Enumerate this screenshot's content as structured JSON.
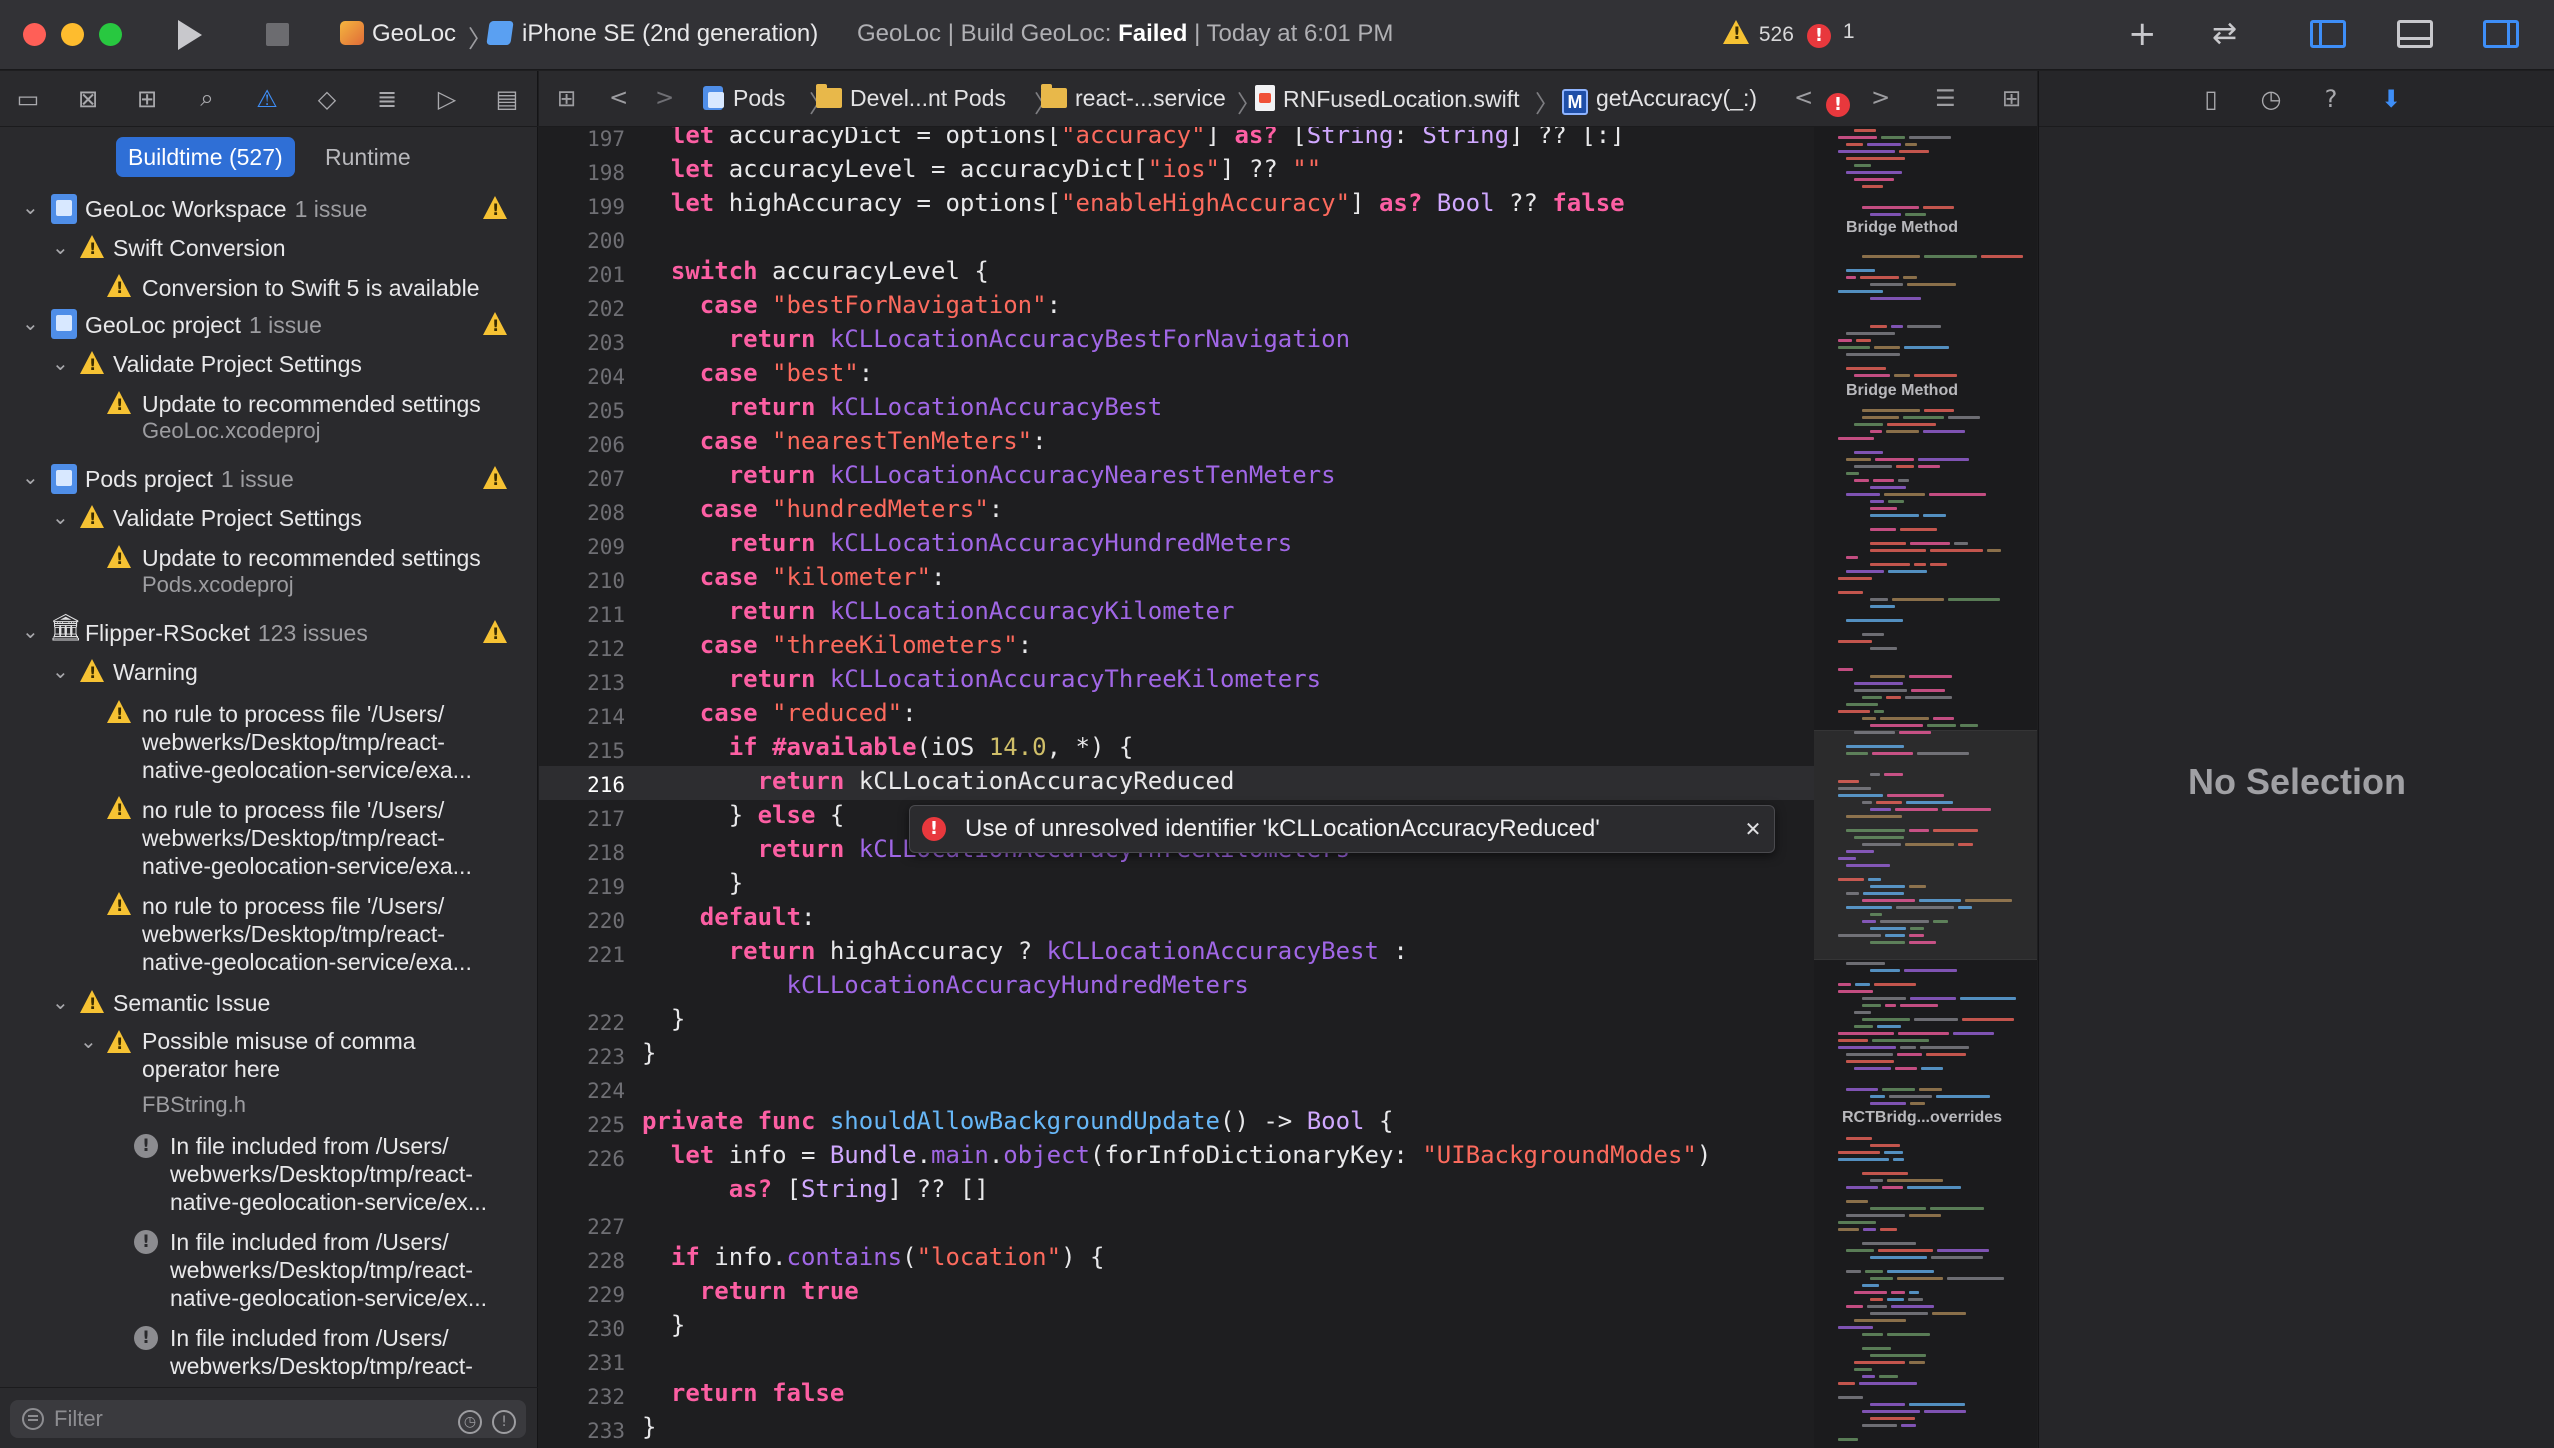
{
  "toolbar": {
    "scheme": "GeoLoc",
    "device": "iPhone SE (2nd generation)",
    "status_prefix": "GeoLoc | Build GeoLoc: ",
    "status_result": "Failed",
    "status_suffix": " | Today at 6:01 PM",
    "warning_count": "526",
    "error_count": "1"
  },
  "navigator": {
    "segment_active": "Buildtime (527)",
    "segment_inactive": "Runtime",
    "filter_placeholder": "Filter",
    "groups": {
      "workspace": {
        "name": "GeoLoc Workspace",
        "meta": "1 issue"
      },
      "swift_conversion": "Swift Conversion",
      "swift_conversion_item": "Conversion to Swift 5 is available",
      "geoloc_project": {
        "name": "GeoLoc project",
        "meta": "1 issue"
      },
      "validate1": "Validate Project Settings",
      "update1": "Update to recommended settings",
      "update1_file": "GeoLoc.xcodeproj",
      "pods_project": {
        "name": "Pods project",
        "meta": "1 issue"
      },
      "validate2": "Validate Project Settings",
      "update2": "Update to recommended settings",
      "update2_file": "Pods.xcodeproj",
      "flipper": {
        "name": "Flipper-RSocket",
        "meta": "123 issues"
      },
      "warning": "Warning",
      "rule1": "no rule to process file '/Users/ webwerks/Desktop/tmp/react-native-geolocation-service/exa...",
      "rule2": "no rule to process file '/Users/ webwerks/Desktop/tmp/react-native-geolocation-service/exa...",
      "rule3": "no rule to process file '/Users/ webwerks/Desktop/tmp/react-native-geolocation-service/exa...",
      "semantic": "Semantic Issue",
      "comma": "Possible misuse of comma operator here",
      "comma_file": "FBString.h",
      "incl1": "In file included from /Users/ webwerks/Desktop/tmp/react-native-geolocation-service/ex...",
      "incl2": "In file included from /Users/ webwerks/Desktop/tmp/react-native-geolocation-service/ex...",
      "incl3": "In file included from /Users/ webwerks/Desktop/tmp/react-"
    }
  },
  "jumpbar": {
    "pods": "Pods",
    "devel": "Devel...nt Pods",
    "react": "react-...service",
    "file": "RNFusedLocation.swift",
    "method": "getAccuracy(_:)",
    "method_badge": "M"
  },
  "editor": {
    "current_line": "216",
    "error_message": "Use of unresolved identifier 'kCLLocationAccuracyReduced'"
  },
  "minimap": {
    "label1": "Bridge Method",
    "label2": "Bridge Method",
    "label3": "RCTBridg...overrides"
  },
  "inspector": {
    "empty_text": "No Selection"
  },
  "colors": {
    "accent": "#3e8ef7",
    "warning": "#f6c233",
    "error": "#e8383d"
  }
}
